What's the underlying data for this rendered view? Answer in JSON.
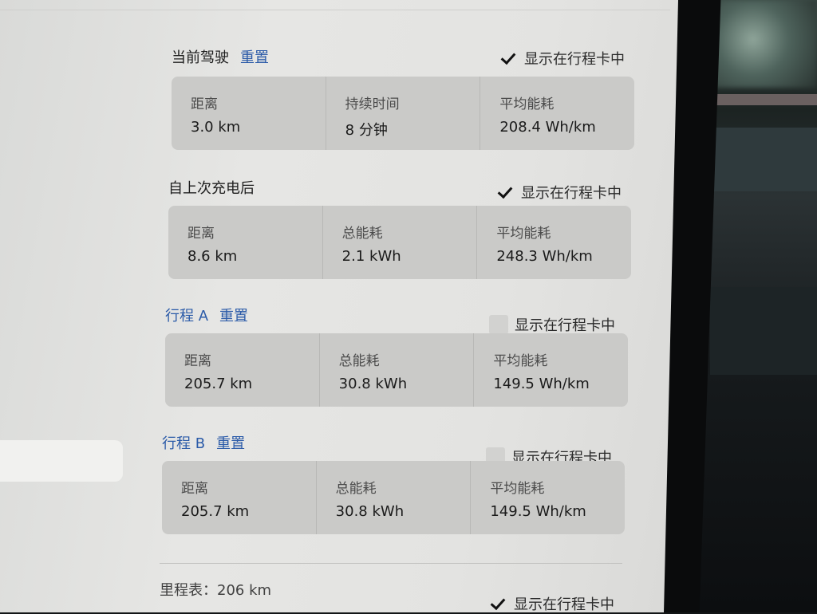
{
  "sections": {
    "current": {
      "title": "当前驾驶",
      "reset": "重置",
      "show_label": "显示在行程卡中",
      "checked": true,
      "metrics": [
        {
          "label": "距离",
          "value": "3.0 km"
        },
        {
          "label": "持续时间",
          "value": "8 分钟"
        },
        {
          "label": "平均能耗",
          "value": "208.4 Wh/km"
        }
      ]
    },
    "since_charge": {
      "title": "自上次充电后",
      "show_label": "显示在行程卡中",
      "checked": true,
      "metrics": [
        {
          "label": "距离",
          "value": "8.6 km"
        },
        {
          "label": "总能耗",
          "value": "2.1 kWh"
        },
        {
          "label": "平均能耗",
          "value": "248.3 Wh/km"
        }
      ]
    },
    "trip_a": {
      "title": "行程 A",
      "reset": "重置",
      "show_label": "显示在行程卡中",
      "checked": false,
      "metrics": [
        {
          "label": "距离",
          "value": "205.7 km"
        },
        {
          "label": "总能耗",
          "value": "30.8 kWh"
        },
        {
          "label": "平均能耗",
          "value": "149.5 Wh/km"
        }
      ]
    },
    "trip_b": {
      "title": "行程 B",
      "reset": "重置",
      "show_label": "显示在行程卡中",
      "checked": false,
      "metrics": [
        {
          "label": "距离",
          "value": "205.7 km"
        },
        {
          "label": "总能耗",
          "value": "30.8 kWh"
        },
        {
          "label": "平均能耗",
          "value": "149.5 Wh/km"
        }
      ]
    }
  },
  "odometer": {
    "text": "里程表：206 km",
    "show_label": "显示在行程卡中",
    "checked": true
  },
  "colors": {
    "accent": "#2a5aa8",
    "card": "#cacac8",
    "screen": "#e4e4e2"
  }
}
